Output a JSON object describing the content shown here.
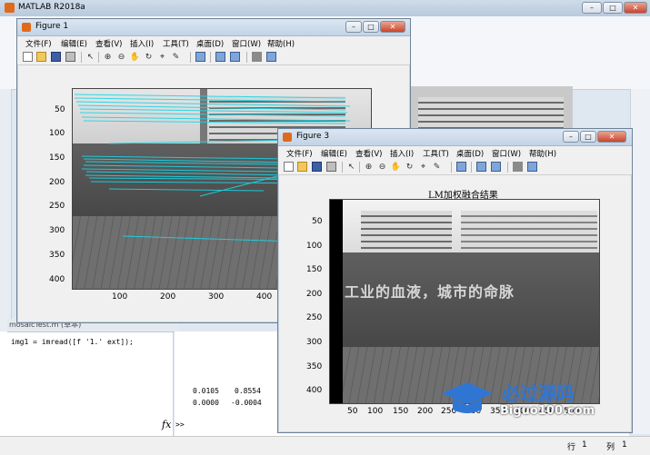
{
  "app": {
    "title": "MATLAB R2018a",
    "editor_tab": "mosaicTest.m  (草本)",
    "editor_code": "img1 = imread([f '1.' ext]);",
    "cmd_values": [
      "0.0105",
      "0.8554",
      "0.0000",
      "-0.0004"
    ],
    "cmd_prompt": ">>",
    "fx_label": "fx",
    "status": {
      "row_label": "行",
      "row": "1",
      "col_label": "列",
      "col": "1"
    }
  },
  "figure1": {
    "title": "Figure 1",
    "menu": [
      "文件(F)",
      "编辑(E)",
      "查看(V)",
      "插入(I)",
      "工具(T)",
      "桌面(D)",
      "窗口(W)",
      "帮助(H)"
    ],
    "y_ticks": [
      "50",
      "100",
      "150",
      "200",
      "250",
      "300",
      "350",
      "400"
    ],
    "x_ticks": [
      "100",
      "200",
      "300",
      "400"
    ]
  },
  "figure3": {
    "title": "Figure 3",
    "menu": [
      "文件(F)",
      "编辑(E)",
      "查看(V)",
      "插入(I)",
      "工具(T)",
      "桌面(D)",
      "窗口(W)",
      "帮助(H)"
    ],
    "axes_title": "LM加权融合结果",
    "banner": "工业的血液，城市的命脉",
    "y_ticks": [
      "50",
      "100",
      "150",
      "200",
      "250",
      "300",
      "350",
      "400"
    ],
    "x_ticks": [
      "50",
      "100",
      "150",
      "200",
      "250",
      "300",
      "350",
      "400",
      "450",
      "500"
    ]
  },
  "watermark": {
    "text": "必过源码",
    "url": "Biguo100.com"
  },
  "colors": {
    "match_lines": "#19d6e6",
    "title_accent": "#e06a1c"
  },
  "icons": [
    "new-file-icon",
    "open-folder-icon",
    "save-icon",
    "print-icon",
    "pointer-icon",
    "zoom-in-icon",
    "zoom-out-icon",
    "pan-icon",
    "rotate-icon",
    "data-cursor-icon",
    "brush-icon",
    "link-icon",
    "colorbar-icon",
    "legend-icon",
    "hide-tools-icon",
    "dock-icon"
  ]
}
